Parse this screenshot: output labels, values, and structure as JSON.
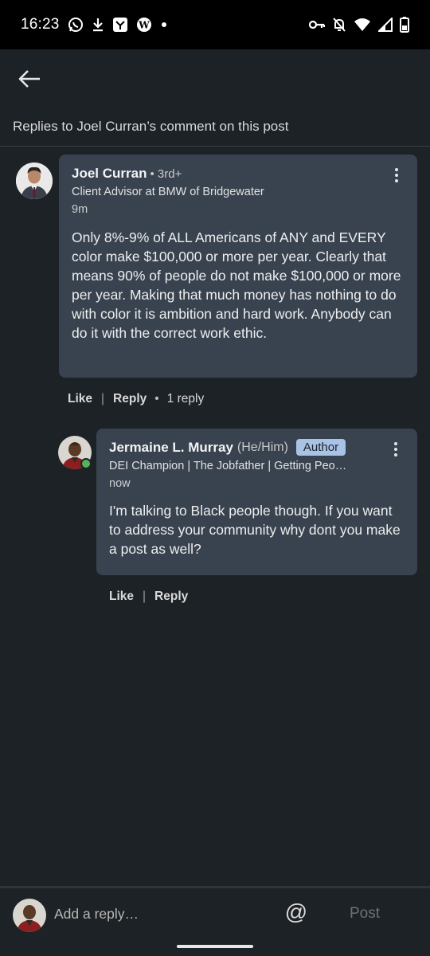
{
  "status_bar": {
    "time": "16:23",
    "left_icons": [
      "whatsapp-icon",
      "download-icon",
      "app-icon",
      "wordpress-icon",
      "dot-icon"
    ],
    "right_icons": [
      "vpn-key-icon",
      "notifications-off-icon",
      "wifi-icon",
      "signal-icon",
      "battery-icon"
    ]
  },
  "header": {
    "back_icon": "back-arrow-icon",
    "subtitle": "Replies to Joel Curran’s comment on this post"
  },
  "comment": {
    "author": "Joel Curran",
    "degree": "• 3rd+",
    "headline": "Client Advisor at BMW of Bridgewater",
    "time": "9m",
    "text": "Only 8%-9% of ALL Americans of ANY and EVERY color make $100,000 or more per year. Clearly that means 90% of people do not make $100,000 or more per year. Making that much money has nothing to do with color it is ambition and hard work. Anybody can do it with the correct work ethic.",
    "actions": {
      "like": "Like",
      "separator": "|",
      "reply": "Reply",
      "dot": "•",
      "reply_count": "1 reply"
    }
  },
  "reply": {
    "author": "Jermaine L. Murray",
    "pronouns": "(He/Him)",
    "badge": "Author",
    "headline": "DEI Champion | The Jobfather | Getting Peo…",
    "time": "now",
    "text": "I'm talking to Black people though. If you want to address your community why dont you make a post as well?",
    "actions": {
      "like": "Like",
      "separator": "|",
      "reply": "Reply"
    }
  },
  "composer": {
    "placeholder": "Add a reply…",
    "mention_symbol": "@",
    "post_label": "Post"
  },
  "colors": {
    "background": "#1d2226",
    "bubble": "#38434f",
    "author_badge": "#a8c3e6",
    "online_dot": "#57b15b"
  }
}
